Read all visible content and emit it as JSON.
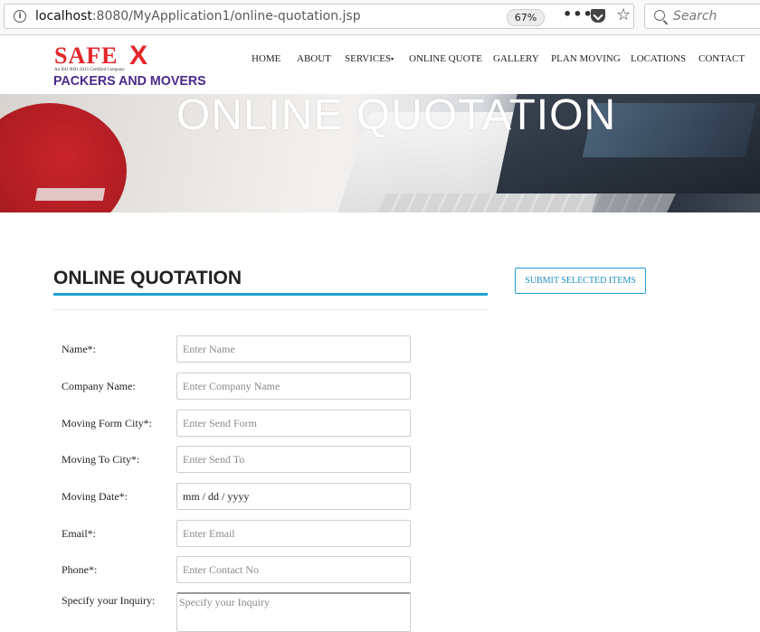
{
  "browser": {
    "url_host": "localhost",
    "url_rest": ":8080/MyApplication1/online-quotation.jsp",
    "zoom": "67%",
    "search_placeholder": "Search"
  },
  "logo": {
    "brand": "SAFE",
    "brand_x": "X",
    "certified": "An ISO 9001:2015 Certified Company",
    "tagline": "PACKERS AND MOVERS"
  },
  "nav": {
    "items": [
      "HOME",
      "ABOUT",
      "SERVICES",
      "ONLINE QUOTE",
      "GALLERY",
      "PLAN MOVING",
      "LOCATIONS",
      "CONTACT"
    ],
    "services_caret": "▾"
  },
  "hero": {
    "title": "ONLINE QUOTATION"
  },
  "main": {
    "section_title": "ONLINE QUOTATION",
    "submit_button": "SUBMIT SELECTED ITEMS",
    "form": {
      "name_label": "Name*:",
      "name_placeholder": "Enter Name",
      "company_label": "Company Name:",
      "company_placeholder": "Enter Company Name",
      "from_city_label": "Moving Form City*:",
      "from_city_placeholder": "Enter Send Form",
      "to_city_label": "Moving To City*:",
      "to_city_placeholder": "Enter Send To",
      "date_label": "Moving Date*:",
      "date_value": "mm / dd / yyyy",
      "email_label": "Email*:",
      "email_placeholder": "Enter Email",
      "phone_label": "Phone*:",
      "phone_placeholder": "Enter Contact No",
      "inquiry_label": "Specify your Inquiry:",
      "inquiry_placeholder": "Specify your Inquiry"
    }
  },
  "colors": {
    "accent": "#1fa1d6",
    "logo_red": "#e3262a",
    "logo_purple": "#4b2b8c"
  }
}
